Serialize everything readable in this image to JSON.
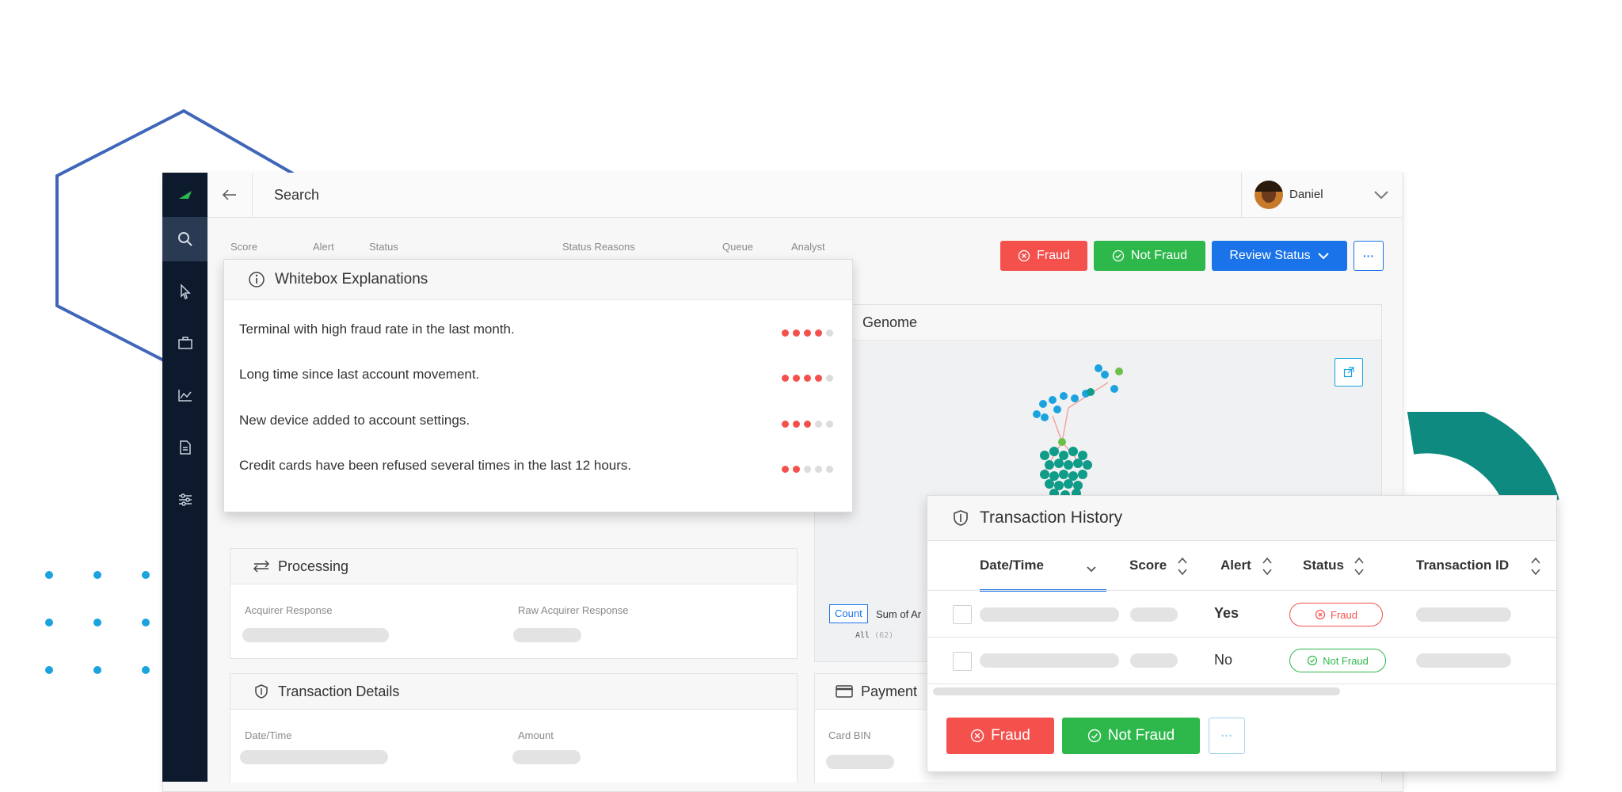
{
  "topbar": {
    "search_label": "Search",
    "user_name": "Daniel"
  },
  "filters": {
    "score": "Score",
    "alert": "Alert",
    "status": "Status",
    "status_reasons": "Status Reasons",
    "queue": "Queue",
    "analyst": "Analyst"
  },
  "actions": {
    "fraud": "Fraud",
    "not_fraud": "Not Fraud",
    "review_status": "Review Status",
    "more": "···"
  },
  "whitebox": {
    "title": "Whitebox Explanations",
    "items": [
      {
        "text": "Terminal with high fraud rate in the last month.",
        "level": 4
      },
      {
        "text": "Long time since last account movement.",
        "level": 4
      },
      {
        "text": "New device added to account settings.",
        "level": 3
      },
      {
        "text": "Credit cards have been refused several times in the last 12 hours.",
        "level": 2
      }
    ]
  },
  "genome": {
    "title": "Genome",
    "count_tab": "Count",
    "sum_tab": "Sum of Ar",
    "all_label": "All",
    "all_count": "(62)"
  },
  "processing": {
    "title": "Processing",
    "acquirer_response": "Acquirer Response",
    "raw_acquirer_response": "Raw Acquirer Response"
  },
  "transaction_details": {
    "title": "Transaction Details",
    "date_time": "Date/Time",
    "amount": "Amount"
  },
  "payment": {
    "title": "Payment",
    "card_bin": "Card BIN"
  },
  "history": {
    "title": "Transaction History",
    "columns": [
      "Date/Time",
      "Score",
      "Alert",
      "Status",
      "Transaction ID"
    ],
    "rows": [
      {
        "alert": "Yes",
        "status": "Fraud"
      },
      {
        "alert": "No",
        "status": "Not Fraud"
      }
    ],
    "fraud_button": "Fraud",
    "not_fraud_button": "Not Fraud",
    "more_button": "···"
  },
  "colors": {
    "sidebar": "#0d1a2e",
    "fraud": "#f4514d",
    "not_fraud": "#2eb84c",
    "review": "#1a73e8",
    "accent_blue": "#3f66b8",
    "teal": "#0f8a80",
    "dot_red": "#f4514d",
    "dot_grey": "#dcdcdc"
  }
}
